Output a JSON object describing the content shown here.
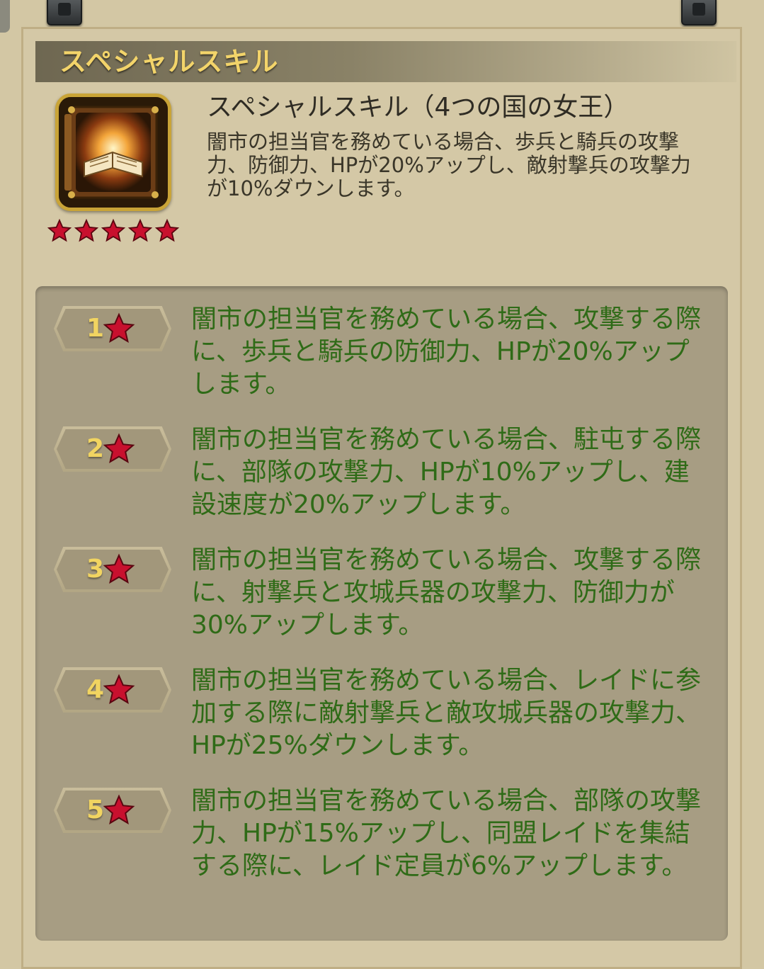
{
  "header": {
    "title": "スペシャルスキル"
  },
  "skill": {
    "name": "スペシャルスキル（4つの国の女王）",
    "description": "闇市の担当官を務めている場合、歩兵と騎兵の攻撃力、防御力、HPが20%アップし、敵射撃兵の攻撃力が10%ダウンします。",
    "icon": "spell-book-icon",
    "star_rating": 5
  },
  "levels": [
    {
      "number": "1",
      "text": "闇市の担当官を務めている場合、攻撃する際に、歩兵と騎兵の防御力、HPが20%アップします。"
    },
    {
      "number": "2",
      "text": "闇市の担当官を務めている場合、駐屯する際に、部隊の攻撃力、HPが10%アップし、建設速度が20%アップします。"
    },
    {
      "number": "3",
      "text": "闇市の担当官を務めている場合、攻撃する際に、射撃兵と攻城兵器の攻撃力、防御力が30%アップします。"
    },
    {
      "number": "4",
      "text": "闇市の担当官を務めている場合、レイドに参加する際に敵射撃兵と敵攻城兵器の攻撃力、HPが25%ダウンします。"
    },
    {
      "number": "5",
      "text": "闇市の担当官を務めている場合、部隊の攻撃力、HPが15%アップし、同盟レイドを集結する際に、レイド定員が6%アップします。"
    }
  ],
  "colors": {
    "title_gold": "#f3d46a",
    "level_text_green": "#2f6b17",
    "star_red": "#c8102e",
    "panel_bg": "#a79d83"
  }
}
